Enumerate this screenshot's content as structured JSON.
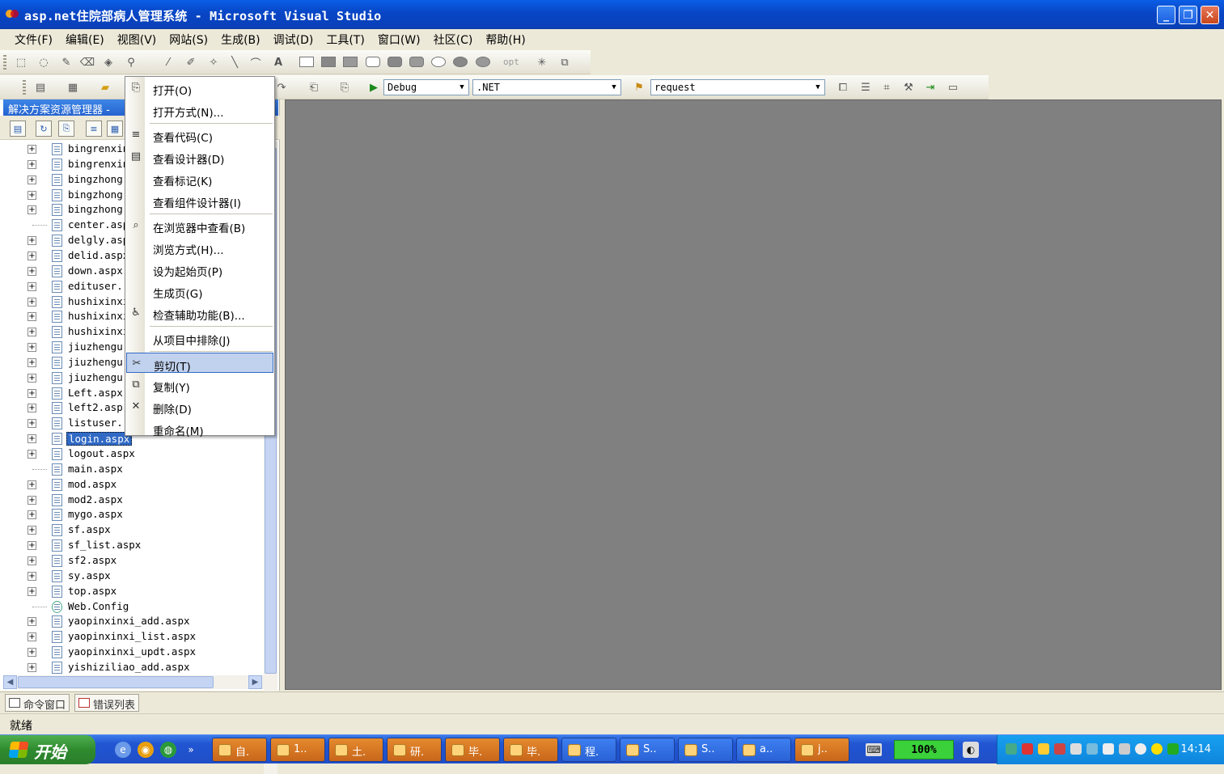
{
  "window": {
    "title": "asp.net住院部病人管理系统 - Microsoft Visual Studio",
    "minimize": "_",
    "restore": "❐",
    "close": "✕"
  },
  "menu": [
    "文件(F)",
    "编辑(E)",
    "视图(V)",
    "网站(S)",
    "生成(B)",
    "调试(D)",
    "工具(T)",
    "窗口(W)",
    "社区(C)",
    "帮助(H)"
  ],
  "toolbar": {
    "opt_label": "opt",
    "config_value": "Debug",
    "platform_value": ".NET",
    "find_value": "request"
  },
  "solution_explorer": {
    "title": "解决方案资源管理器 - ",
    "files": [
      {
        "name": "bingrenxin",
        "expandable": true
      },
      {
        "name": "bingrenxin",
        "expandable": true
      },
      {
        "name": "bingzhong",
        "expandable": true
      },
      {
        "name": "bingzhong",
        "expandable": true
      },
      {
        "name": "bingzhong",
        "expandable": true
      },
      {
        "name": "center.asp",
        "expandable": false
      },
      {
        "name": "delgly.asp",
        "expandable": true
      },
      {
        "name": "delid.aspx",
        "expandable": true
      },
      {
        "name": "down.aspx",
        "expandable": true
      },
      {
        "name": "edituser.",
        "expandable": true
      },
      {
        "name": "hushixinxi",
        "expandable": true
      },
      {
        "name": "hushixinxi",
        "expandable": true
      },
      {
        "name": "hushixinxi",
        "expandable": true
      },
      {
        "name": "jiuzhengu",
        "expandable": true
      },
      {
        "name": "jiuzhengu",
        "expandable": true
      },
      {
        "name": "jiuzhengu",
        "expandable": true
      },
      {
        "name": "Left.aspx",
        "expandable": true
      },
      {
        "name": "left2.asp",
        "expandable": true
      },
      {
        "name": "listuser.",
        "expandable": true
      },
      {
        "name": "login.aspx",
        "expandable": true,
        "selected": true
      },
      {
        "name": "logout.aspx",
        "expandable": true
      },
      {
        "name": "main.aspx",
        "expandable": false
      },
      {
        "name": "mod.aspx",
        "expandable": true
      },
      {
        "name": "mod2.aspx",
        "expandable": true
      },
      {
        "name": "mygo.aspx",
        "expandable": true
      },
      {
        "name": "sf.aspx",
        "expandable": true
      },
      {
        "name": "sf_list.aspx",
        "expandable": true
      },
      {
        "name": "sf2.aspx",
        "expandable": true
      },
      {
        "name": "sy.aspx",
        "expandable": true
      },
      {
        "name": "top.aspx",
        "expandable": true
      },
      {
        "name": "Web.Config",
        "expandable": false,
        "config": true
      },
      {
        "name": "yaopinxinxi_add.aspx",
        "expandable": true
      },
      {
        "name": "yaopinxinxi_list.aspx",
        "expandable": true
      },
      {
        "name": "yaopinxinxi_updt.aspx",
        "expandable": true
      },
      {
        "name": "yishiziliao_add.aspx",
        "expandable": true
      }
    ]
  },
  "context_menu": {
    "items": [
      {
        "label": "打开(O)",
        "icon": "open-icon"
      },
      {
        "label": "打开方式(N)...",
        "icon": ""
      },
      {
        "sep": true
      },
      {
        "label": "查看代码(C)",
        "icon": "code-icon"
      },
      {
        "label": "查看设计器(D)",
        "icon": "designer-icon"
      },
      {
        "label": "查看标记(K)",
        "icon": ""
      },
      {
        "label": "查看组件设计器(I)",
        "icon": ""
      },
      {
        "sep": true
      },
      {
        "label": "在浏览器中查看(B)",
        "icon": "browser-icon"
      },
      {
        "label": "浏览方式(H)...",
        "icon": ""
      },
      {
        "label": "设为起始页(P)",
        "icon": ""
      },
      {
        "label": "生成页(G)",
        "icon": ""
      },
      {
        "label": "检查辅助功能(B)...",
        "icon": "accessibility-icon"
      },
      {
        "sep": true
      },
      {
        "label": "从项目中排除(J)",
        "icon": ""
      },
      {
        "sep": true
      },
      {
        "label": "剪切(T)",
        "icon": "cut-icon",
        "highlight": true
      },
      {
        "label": "复制(Y)",
        "icon": "copy-icon"
      },
      {
        "label": "删除(D)",
        "icon": "delete-icon"
      },
      {
        "label": "重命名(M)",
        "icon": ""
      }
    ]
  },
  "bottom_tabs": [
    "命令窗口",
    "错误列表"
  ],
  "status": "就绪",
  "taskbar": {
    "start_label": "开始",
    "tasks": [
      {
        "label": "自.",
        "color": "orange"
      },
      {
        "label": "1..",
        "color": "orange"
      },
      {
        "label": "土.",
        "color": "orange"
      },
      {
        "label": "研.",
        "color": "orange"
      },
      {
        "label": "毕.",
        "color": "orange"
      },
      {
        "label": "毕.",
        "color": "orange"
      },
      {
        "label": "程.",
        "color": "blue"
      },
      {
        "label": "S..",
        "color": "blue"
      },
      {
        "label": "S..",
        "color": "blue"
      },
      {
        "label": "a..",
        "color": "blue"
      },
      {
        "label": "j..",
        "color": "orange"
      }
    ],
    "zoom": "100%",
    "clock": "14:14"
  }
}
